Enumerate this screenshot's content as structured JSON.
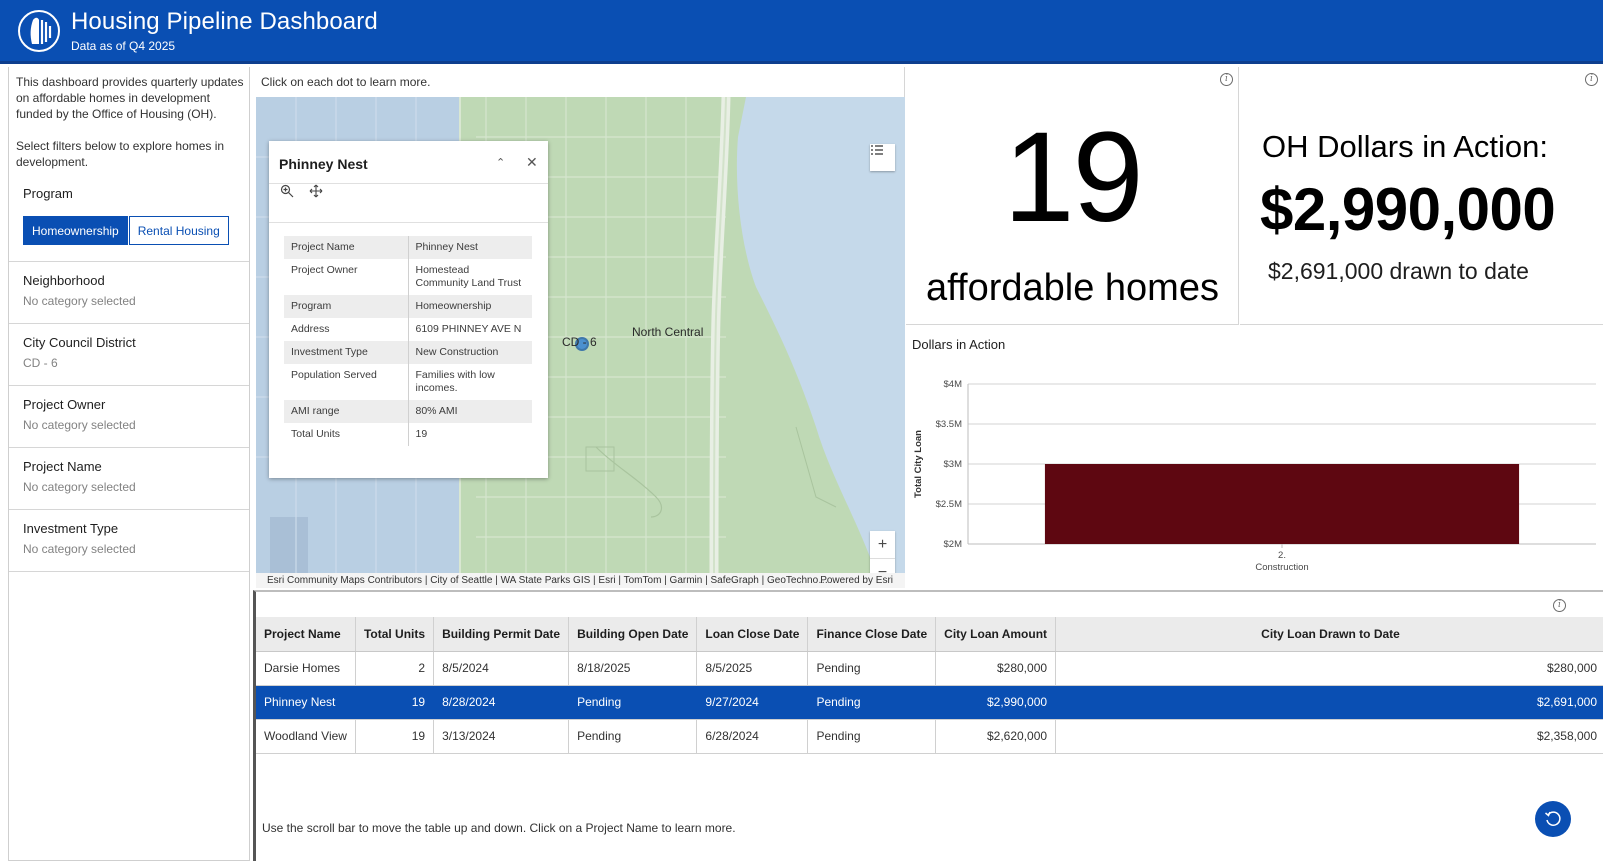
{
  "header": {
    "title": "Housing Pipeline Dashboard",
    "subtitle": "Data as of Q4 2025"
  },
  "sidebar": {
    "intro_1": "This dashboard provides quarterly updates on affordable homes in development funded by the Office of Housing (OH).",
    "intro_2": "Select filters below to explore homes in development.",
    "program_label": "Program",
    "program_options": [
      "Homeownership",
      "Rental Housing"
    ],
    "program_selected": "Homeownership",
    "filters": [
      {
        "label": "Neighborhood",
        "value": "No category selected"
      },
      {
        "label": "City Council District",
        "value": "CD - 6"
      },
      {
        "label": "Project Owner",
        "value": "No category selected"
      },
      {
        "label": "Project Name",
        "value": "No category selected"
      },
      {
        "label": "Investment Type",
        "value": "No category selected"
      }
    ]
  },
  "map": {
    "caption": "Click on each dot to learn more.",
    "label_district": "CD - 6",
    "label_neighborhood": "North Central",
    "attribution": "Esri Community Maps Contributors | City of Seattle | WA State Parks GIS | Esri | TomTom | Garmin | SafeGraph | GeoTechno…",
    "powered_by": "Powered by Esri",
    "zoom_in": "+",
    "zoom_out": "−"
  },
  "popup": {
    "title": "Phinney Nest",
    "fields": [
      {
        "label": "Project Name",
        "value": "Phinney Nest"
      },
      {
        "label": "Project Owner",
        "value": "Homestead Community Land Trust"
      },
      {
        "label": "Program",
        "value": "Homeownership"
      },
      {
        "label": "Address",
        "value": "6109 PHINNEY AVE N"
      },
      {
        "label": "Investment Type",
        "value": "New Construction"
      },
      {
        "label": "Population Served",
        "value": "Families with low incomes."
      },
      {
        "label": "AMI range",
        "value": "80% AMI"
      },
      {
        "label": "Total Units",
        "value": "19"
      }
    ]
  },
  "kpi_homes": {
    "value": "19",
    "label": "affordable homes"
  },
  "kpi_dollars": {
    "title": "OH Dollars in Action:",
    "value": "$2,990,000",
    "sub": "$2,691,000 drawn to date"
  },
  "chart_data": {
    "type": "bar",
    "title": "Dollars in Action",
    "ylabel": "Total City Loan",
    "xlabel": "",
    "categories": [
      "2. Construction"
    ],
    "category_lines": [
      [
        "2.",
        "Construction"
      ]
    ],
    "values": [
      3000000
    ],
    "ylim": [
      2000000,
      4000000
    ],
    "yticks": [
      2000000,
      2500000,
      3000000,
      3500000,
      4000000
    ],
    "ytick_labels": [
      "$2M",
      "$2.5M",
      "$3M",
      "$3.5M",
      "$4M"
    ],
    "bar_color": "#5e0711",
    "grid": true
  },
  "table": {
    "columns": [
      "Project Name",
      "Total Units",
      "Building Permit Date",
      "Building Open Date",
      "Loan Close Date",
      "Finance Close Date",
      "City Loan Amount",
      "City Loan Drawn to Date"
    ],
    "rows": [
      [
        "Darsie Homes",
        "2",
        "8/5/2024",
        "8/18/2025",
        "8/5/2025",
        "Pending",
        "$280,000",
        "$280,000"
      ],
      [
        "Phinney Nest",
        "19",
        "8/28/2024",
        "Pending",
        "9/27/2024",
        "Pending",
        "$2,990,000",
        "$2,691,000"
      ],
      [
        "Woodland View",
        "19",
        "3/13/2024",
        "Pending",
        "6/28/2024",
        "Pending",
        "$2,620,000",
        "$2,358,000"
      ]
    ],
    "selected_row": "Phinney Nest",
    "footer": "Use the scroll bar to move the table up and down. Click on a Project Name to learn more."
  },
  "colors": {
    "header_blue": "#0a4fb3",
    "selected_row": "#0a4fb3",
    "bar": "#5e0711",
    "map_land": "#bfd9b5",
    "map_water": "#b9cfe3"
  }
}
